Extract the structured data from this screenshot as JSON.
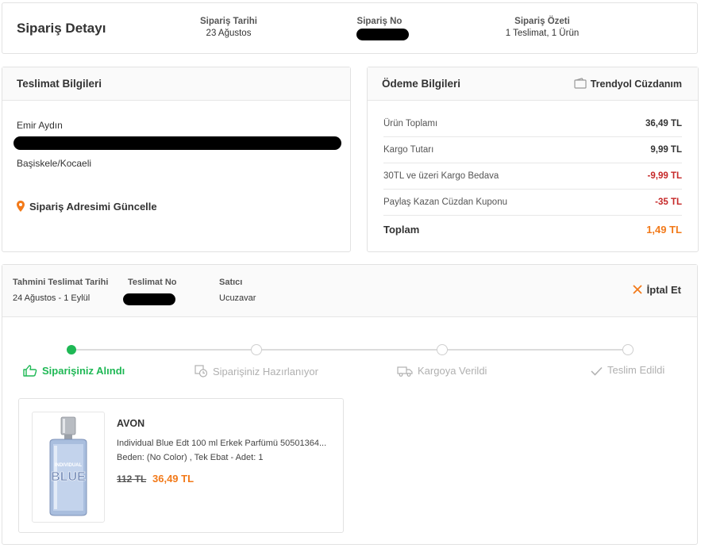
{
  "header": {
    "title": "Sipariş Detayı",
    "order_date_label": "Sipariş Tarihi",
    "order_date_value": "23 Ağustos",
    "order_no_label": "Sipariş No",
    "summary_label": "Sipariş Özeti",
    "summary_value": "1 Teslimat, 1 Ürün"
  },
  "shipping": {
    "title": "Teslimat Bilgileri",
    "name": "Emir Aydın",
    "district": "Başiskele/Kocaeli",
    "update_link": "Sipariş Adresimi Güncelle"
  },
  "payment": {
    "title": "Ödeme Bilgileri",
    "wallet_label": "Trendyol Cüzdanım",
    "rows": [
      {
        "label": "Ürün Toplamı",
        "value": "36,49 TL"
      },
      {
        "label": "Kargo Tutarı",
        "value": "9,99 TL"
      },
      {
        "label": "30TL ve üzeri Kargo Bedava",
        "value": "-9,99 TL"
      },
      {
        "label": "Paylaş Kazan Cüzdan Kuponu",
        "value": "-35 TL"
      }
    ],
    "total_label": "Toplam",
    "total_value": "1,49 TL",
    "colors": {
      "discount": "#c62828",
      "total": "#f27a1a"
    }
  },
  "delivery": {
    "est_label": "Tahmini Teslimat Tarihi",
    "est_value": "24 Ağustos - 1 Eylül",
    "delivery_no_label": "Teslimat No",
    "seller_label": "Satıcı",
    "seller_value": "Ucuzavar",
    "cancel_label": "İptal Et",
    "steps": [
      {
        "label": "Siparişiniz Alındı",
        "icon": "thumbs-up-icon",
        "active": true
      },
      {
        "label": "Siparişiniz Hazırlanıyor",
        "icon": "clock-box-icon",
        "active": false
      },
      {
        "label": "Kargoya Verildi",
        "icon": "truck-icon",
        "active": false
      },
      {
        "label": "Teslim Edildi",
        "icon": "check-icon",
        "active": false
      }
    ],
    "colors": {
      "active": "#1fb855",
      "inactive": "#b0b0b0"
    }
  },
  "product": {
    "brand": "AVON",
    "name": "Individual Blue Edt 100 ml Erkek Parfümü 50501364...",
    "variant": "Beden: (No Color) , Tek Ebat - Adet: 1",
    "old_price": "112 TL",
    "price": "36,49 TL",
    "bottle_text_1": "INDIVIDUAL",
    "bottle_text_2": "BLUE"
  }
}
